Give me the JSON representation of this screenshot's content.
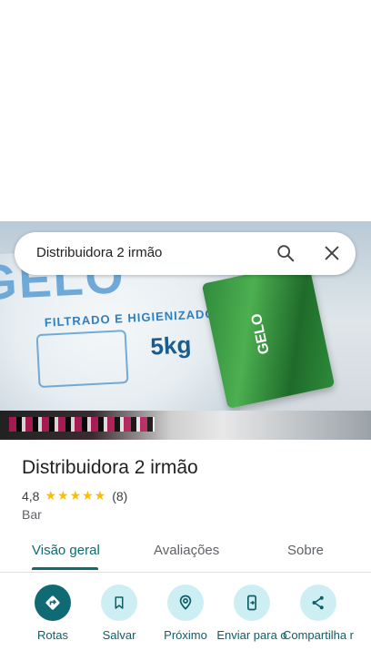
{
  "search": {
    "query": "Distribuidora 2 irmão"
  },
  "photo": {
    "bag_logo": "GELO",
    "bag_text": "FILTRADO E HIGIENIZADO",
    "bag_weight": "5kg",
    "green_bag_text": "GELO"
  },
  "place": {
    "title": "Distribuidora 2 irmão",
    "rating": "4,8",
    "stars": "★★★★★",
    "reviews": "(8)",
    "type": "Bar"
  },
  "tabs": [
    {
      "label": "Visão geral",
      "active": true
    },
    {
      "label": "Avaliações",
      "active": false
    },
    {
      "label": "Sobre",
      "active": false
    }
  ],
  "actions": [
    {
      "label": "Rotas",
      "icon": "directions-icon"
    },
    {
      "label": "Salvar",
      "icon": "bookmark-icon"
    },
    {
      "label": "Próximo",
      "icon": "nearby-icon"
    },
    {
      "label": "Enviar para o",
      "icon": "send-to-phone-icon"
    },
    {
      "label": "Compartilha r",
      "icon": "share-icon"
    }
  ],
  "colors": {
    "accent": "#0f6a74",
    "action_bg": "#cdeff4",
    "star": "#fbbc04"
  }
}
